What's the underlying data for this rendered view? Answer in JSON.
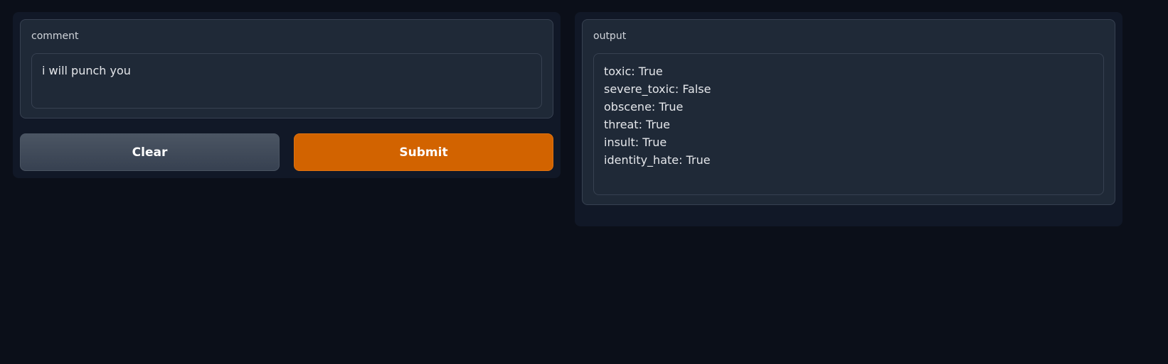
{
  "input": {
    "label": "comment",
    "value": "i will punch you"
  },
  "buttons": {
    "clear_label": "Clear",
    "submit_label": "Submit"
  },
  "output": {
    "label": "output",
    "lines": [
      "toxic: True",
      "severe_toxic: False",
      "obscene: True",
      "threat: True",
      "insult: True",
      "identity_hate: True"
    ]
  },
  "colors": {
    "background": "#0b0f19",
    "panel": "#111827",
    "block": "#1f2937",
    "border": "#374151",
    "submit_accent": "#d26300",
    "clear_button": "#4b5563"
  }
}
